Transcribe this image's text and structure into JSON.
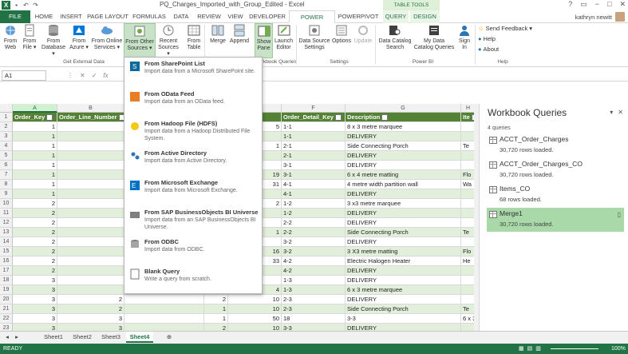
{
  "window": {
    "title": "PQ_Charges_Imported_with_Group_Edited - Excel",
    "contextual_group": "TABLE TOOLS",
    "controls": [
      "?",
      "▭",
      "−",
      "□",
      "✕"
    ]
  },
  "tabs": [
    "FILE",
    "HOME",
    "INSERT",
    "PAGE LAYOUT",
    "FORMULAS",
    "DATA",
    "REVIEW",
    "VIEW",
    "DEVELOPER",
    "POWER QUERY",
    "POWERPIVOT",
    "QUERY",
    "DESIGN"
  ],
  "user": "kathryn newitt",
  "ribbon": {
    "buttons": [
      {
        "label": "From\nWeb"
      },
      {
        "label": "From\nFile ▾"
      },
      {
        "label": "From\nDatabase ▾"
      },
      {
        "label": "From\nAzure ▾"
      },
      {
        "label": "From Online\nServices ▾"
      },
      {
        "label": "From Other\nSources ▾"
      },
      {
        "label": "Recent\nSources ▾"
      },
      {
        "label": "From\nTable"
      },
      {
        "label": "Merge"
      },
      {
        "label": "Append"
      },
      {
        "label": "Show\nPane"
      },
      {
        "label": "Launch\nEditor"
      },
      {
        "label": "Data Source\nSettings"
      },
      {
        "label": "Options"
      },
      {
        "label": "Update"
      },
      {
        "label": "Data Catalog\nSearch"
      },
      {
        "label": "My Data\nCatalog Queries"
      },
      {
        "label": "Sign\nIn"
      }
    ],
    "groups": [
      "Get External Data",
      "Workbook Queries",
      "Settings",
      "Power BI",
      "Help"
    ],
    "help_items": [
      "Send Feedback ▾",
      "Help",
      "About"
    ]
  },
  "formula_bar": {
    "namebox": "A1",
    "icons": [
      "⋮",
      "✕",
      "✓",
      "fx"
    ]
  },
  "columns": [
    "A",
    "B",
    "C",
    "D",
    "E",
    "F",
    "G",
    "H"
  ],
  "table": {
    "headers": [
      "Order_Key",
      "Order_Line_Number",
      "",
      "",
      "_Key",
      "Order_Detail_Key",
      "Description",
      "Ite"
    ],
    "rows": [
      [
        "1",
        "",
        "",
        "",
        "5",
        "1-1",
        "8 x 3 metre marquee",
        ""
      ],
      [
        "1",
        "",
        "",
        "",
        "",
        "1-1",
        "DELIVERY",
        ""
      ],
      [
        "1",
        "",
        "",
        "",
        "1",
        "2-1",
        "Side Connecting Porch",
        "Te"
      ],
      [
        "1",
        "",
        "",
        "",
        "",
        "2-1",
        "DELIVERY",
        ""
      ],
      [
        "1",
        "",
        "",
        "",
        "",
        "3-1",
        "DELIVERY",
        ""
      ],
      [
        "1",
        "",
        "",
        "",
        "19",
        "3-1",
        "6 x 4 metre matting",
        "Flo"
      ],
      [
        "1",
        "",
        "",
        "",
        "31",
        "4-1",
        "4 metre width partition wall",
        "Wa"
      ],
      [
        "1",
        "",
        "",
        "",
        "",
        "4-1",
        "DELIVERY",
        ""
      ],
      [
        "2",
        "",
        "",
        "",
        "2",
        "1-2",
        "3 x3 metre marquee",
        ""
      ],
      [
        "2",
        "",
        "",
        "",
        "",
        "1-2",
        "DELIVERY",
        ""
      ],
      [
        "2",
        "",
        "",
        "",
        "",
        "2-2",
        "DELIVERY",
        ""
      ],
      [
        "2",
        "",
        "",
        "",
        "1",
        "2-2",
        "Side Connecting Porch",
        "Te"
      ],
      [
        "2",
        "",
        "",
        "",
        "",
        "3-2",
        "DELIVERY",
        ""
      ],
      [
        "2",
        "",
        "",
        "",
        "16",
        "3-2",
        "3 X3 metre matting",
        "Flo"
      ],
      [
        "2",
        "",
        "",
        "",
        "33",
        "4-2",
        "Electric Halogen Heater",
        "He"
      ],
      [
        "2",
        "",
        "",
        "",
        "",
        "4-2",
        "DELIVERY",
        ""
      ],
      [
        "3",
        "",
        "",
        "",
        "",
        "1-3",
        "DELIVERY",
        ""
      ],
      [
        "3",
        "",
        "",
        "",
        "4",
        "1-3",
        "6 x 3 metre marquee",
        ""
      ],
      [
        "3",
        "2",
        "",
        "2",
        "10",
        "2-3",
        "DELIVERY",
        ""
      ],
      [
        "3",
        "2",
        "",
        "1",
        "10",
        "2-3",
        "Side Connecting Porch",
        "Te"
      ],
      [
        "3",
        "3",
        "",
        "1",
        "50",
        "18",
        "3-3",
        "6 x 3 metre matting"
      ],
      [
        "3",
        "3",
        "",
        "2",
        "10",
        "3-3",
        "DELIVERY",
        ""
      ]
    ],
    "rownums": [
      "1",
      "2",
      "3",
      "4",
      "5",
      "6",
      "7",
      "8",
      "9",
      "10",
      "11",
      "12",
      "13",
      "14",
      "15",
      "16",
      "17",
      "18",
      "19",
      "20",
      "21",
      "22",
      "23"
    ]
  },
  "dropdown": [
    {
      "title": "From SharePoint List",
      "desc": "Import data from a Microsoft SharePoint site."
    },
    {
      "title": "From OData Feed",
      "desc": "Import data from an OData feed."
    },
    {
      "title": "From Hadoop File (HDFS)",
      "desc": "Import data from a Hadoop Distributed File System."
    },
    {
      "title": "From Active Directory",
      "desc": "Import data from Active Directory."
    },
    {
      "title": "From Microsoft Exchange",
      "desc": "Import data from Microsoft Exchange."
    },
    {
      "title": "From SAP BusinessObjects BI Universe",
      "desc": "Import data from an SAP BusinessObjects BI Universe."
    },
    {
      "title": "From ODBC",
      "desc": "Import data from ODBC."
    },
    {
      "title": "Blank Query",
      "desc": "Write a query from scratch."
    }
  ],
  "pane": {
    "title": "Workbook Queries",
    "count": "4 queries",
    "queries": [
      {
        "name": "ACCT_Order_Charges",
        "rows": "30,720 rows loaded."
      },
      {
        "name": "ACCT_Order_Charges_CO",
        "rows": "30,720 rows loaded."
      },
      {
        "name": "Items_CO",
        "rows": "68 rows loaded."
      },
      {
        "name": "Merge1",
        "rows": "30,720 rows loaded."
      }
    ]
  },
  "sheets": [
    "Sheet1",
    "Sheet2",
    "Sheet3",
    "Sheet4"
  ],
  "status": {
    "left": "READY",
    "zoom": "100%"
  },
  "colors": {
    "excel_green": "#217346",
    "header_green": "#548235",
    "band": "#e2efda"
  }
}
